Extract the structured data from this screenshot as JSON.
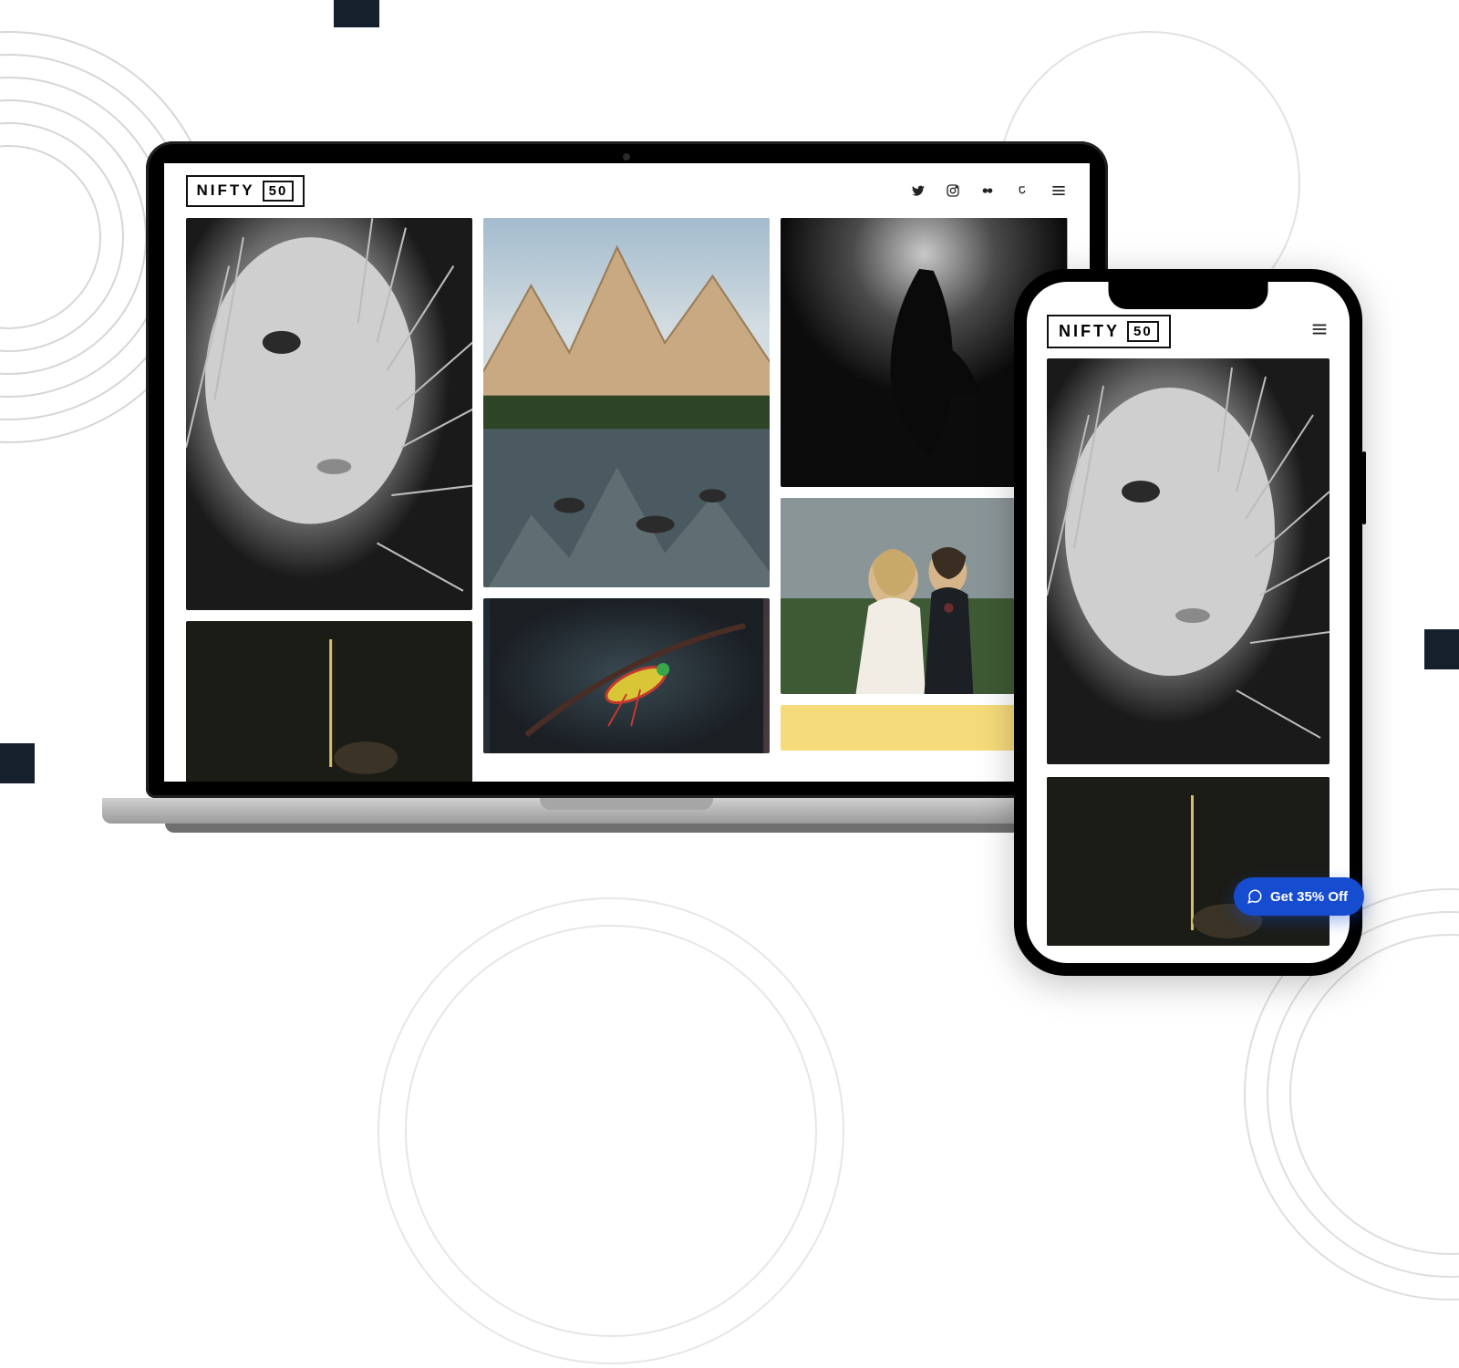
{
  "logo": {
    "name": "NIFTY",
    "num": "50"
  },
  "gallery": {
    "portrait": "bw-portrait-woman",
    "mountains": "mountain-lake-reflection",
    "underwater": "underwater-bw-diver",
    "wedding": "wedding-couple-field",
    "dark": "dark-indoor-shot",
    "insect": "grasshopper-macro",
    "yellow": "yellow-still-life"
  },
  "social": [
    "twitter",
    "instagram",
    "flickr",
    "500px",
    "menu"
  ],
  "chat": {
    "label": "Get 35% Off"
  }
}
